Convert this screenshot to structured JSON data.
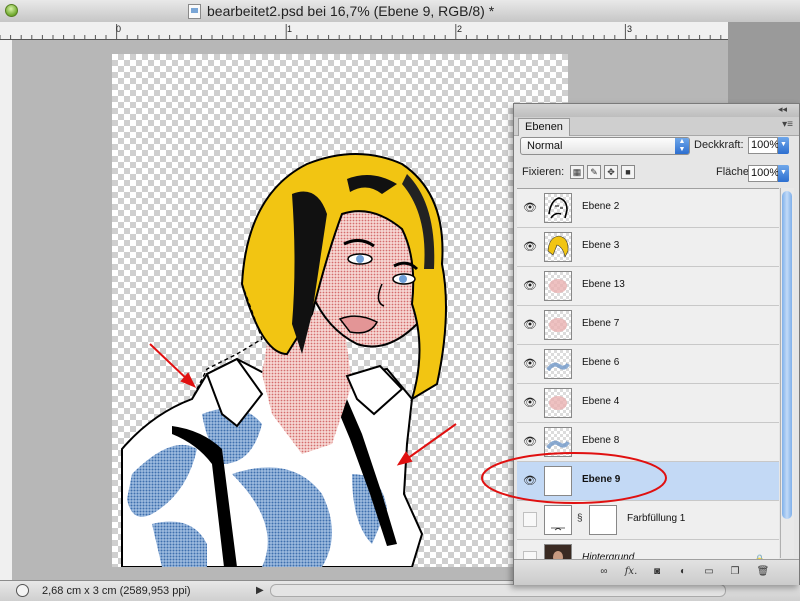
{
  "window": {
    "title": "bearbeitet2.psd bei 16,7% (Ebene 9, RGB/8) *"
  },
  "ruler": {
    "ticks": [
      "0",
      "1",
      "2",
      "3"
    ]
  },
  "status_bar": {
    "doc_info": "2,68 cm x 3 cm (2589,953 ppi)",
    "arrow": "▶"
  },
  "layers_panel": {
    "tab_label": "Ebenen",
    "blend_mode": "Normal",
    "opacity_label": "Deckkraft:",
    "opacity_value": "100%",
    "lock_label": "Fixieren:",
    "fill_label": "Fläche:",
    "fill_value": "100%",
    "layers": [
      {
        "name": "Ebene 2",
        "visible": true,
        "thumb": "lineart",
        "selected": false
      },
      {
        "name": "Ebene 3",
        "visible": true,
        "thumb": "hair-yellow",
        "selected": false
      },
      {
        "name": "Ebene 13",
        "visible": true,
        "thumb": "pink-dots",
        "selected": false
      },
      {
        "name": "Ebene 7",
        "visible": true,
        "thumb": "pink-dots",
        "selected": false
      },
      {
        "name": "Ebene 6",
        "visible": true,
        "thumb": "blue-dots",
        "selected": false
      },
      {
        "name": "Ebene 4",
        "visible": true,
        "thumb": "pink-dots",
        "selected": false
      },
      {
        "name": "Ebene 8",
        "visible": true,
        "thumb": "blue-dots",
        "selected": false
      },
      {
        "name": "Ebene 9",
        "visible": true,
        "thumb": "white",
        "selected": true
      },
      {
        "name": "Farbfüllung 1",
        "visible": false,
        "thumb": "fill-white",
        "selected": false
      },
      {
        "name": "Hintergrund",
        "visible": false,
        "thumb": "photo",
        "selected": false
      }
    ],
    "bottom_buttons": [
      "link-icon",
      "fx-icon",
      "mask-icon",
      "adjustment-icon",
      "folder-icon",
      "new-layer-icon",
      "trash-icon"
    ],
    "fx_label": "fx."
  },
  "colors": {
    "selection_highlight": "#c3d9f5",
    "annotation_red": "#e01010",
    "hair_yellow": "#f2c512",
    "skin_halftone": "#e9a0a0",
    "shirt_blue": "#6f97c8"
  }
}
